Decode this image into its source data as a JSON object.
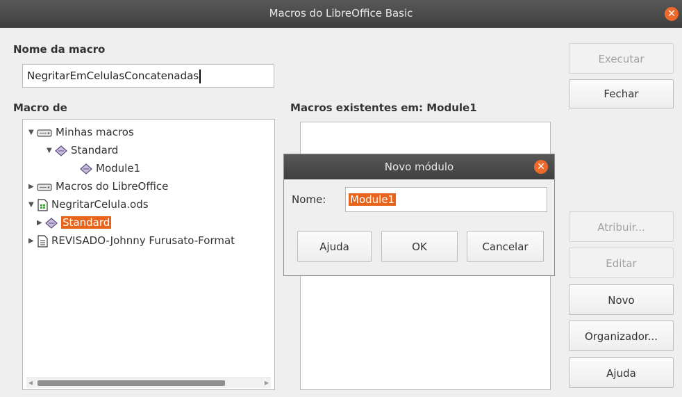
{
  "window": {
    "title": "Macros do LibreOffice Basic"
  },
  "macro_name": {
    "label": "Nome da macro",
    "value": "NegritarEmCelulasConcatenadas"
  },
  "macro_from": {
    "label": "Macro de",
    "tree": [
      {
        "label": "Minhas macros",
        "icon": "drive-icon",
        "expanded": true
      },
      {
        "label": "Standard",
        "icon": "library-icon",
        "expanded": true
      },
      {
        "label": "Module1",
        "icon": "module-icon"
      },
      {
        "label": "Macros do LibreOffice",
        "icon": "drive-icon",
        "expanded": false
      },
      {
        "label": "NegritarCelula.ods",
        "icon": "spreadsheet-icon",
        "expanded": true
      },
      {
        "label": "Standard",
        "icon": "library-icon",
        "expanded": false,
        "selected": true
      },
      {
        "label": "REVISADO-Johnny Furusato-Format",
        "icon": "document-icon",
        "expanded": false
      }
    ]
  },
  "existing_macros": {
    "label": "Macros existentes em: Module1"
  },
  "buttons": {
    "run": "Executar",
    "close": "Fechar",
    "assign": "Atribuir...",
    "edit": "Editar",
    "new": "Novo",
    "organizer": "Organizador...",
    "help": "Ajuda"
  },
  "new_module_dialog": {
    "title": "Novo módulo",
    "name_label": "Nome:",
    "name_value": "Module1",
    "help": "Ajuda",
    "ok": "OK",
    "cancel": "Cancelar"
  },
  "colors": {
    "accent": "#e9641b",
    "titlebar": "#4a4a4a",
    "close": "#ee6a2c"
  }
}
